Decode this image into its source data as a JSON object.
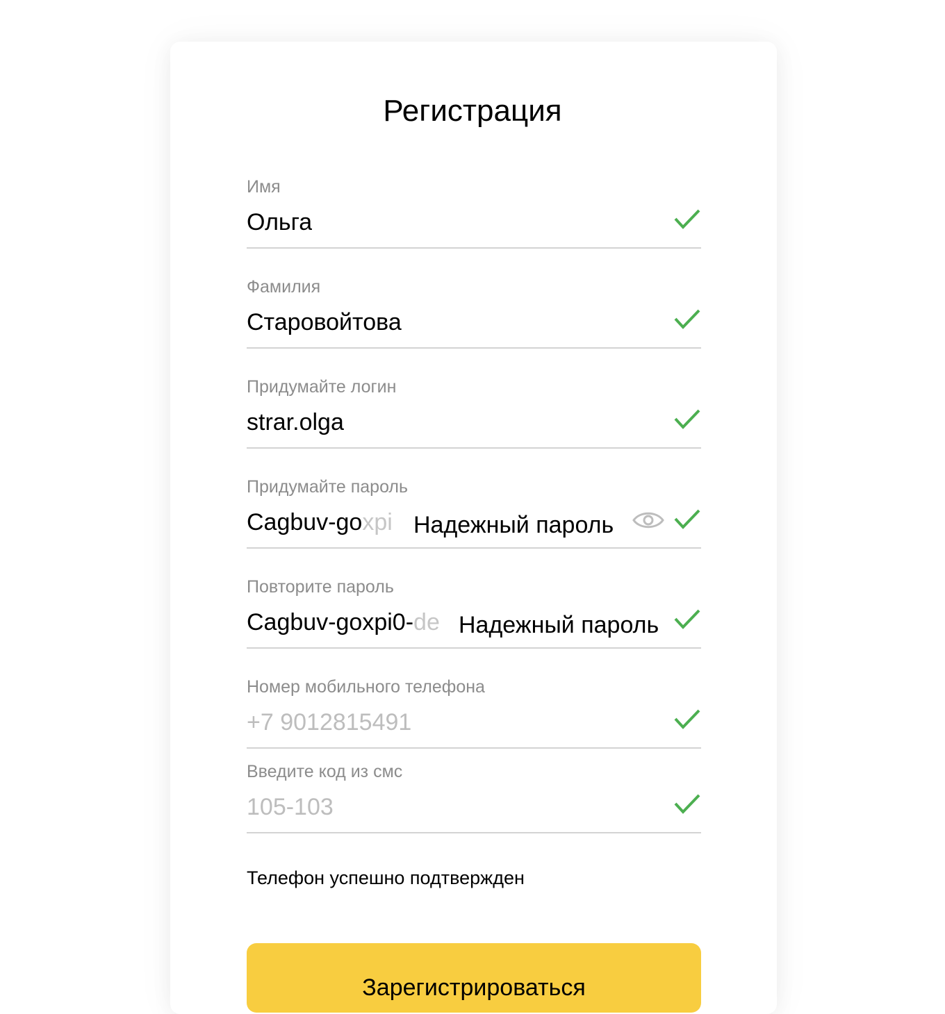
{
  "form": {
    "title": "Регистрация",
    "fields": [
      {
        "label": "Имя",
        "value": "Ольга",
        "valid": true
      },
      {
        "label": "Фамилия",
        "value": "Старовойтова",
        "valid": true
      },
      {
        "label": "Придумайте логин",
        "value": "strar.olga",
        "valid": true
      },
      {
        "label": "Придумайте пароль",
        "value_visible": "Cagbuv-go",
        "value_faded": "xpi",
        "hint": "Надежный пароль",
        "valid": true
      },
      {
        "label": "Повторите пароль",
        "value_visible": "Cagbuv-goxpi0-",
        "value_faded": "de",
        "hint": "Надежный пароль",
        "valid": true
      },
      {
        "label": "Номер мобильного телефона",
        "value": "+7 9012815491",
        "valid": true
      },
      {
        "label": "Введите код из смс",
        "value": "105-103",
        "valid": true
      }
    ],
    "status_text": "Телефон успешно подтвержден",
    "submit_label": "Зарегистрироваться"
  },
  "icons": {
    "check": "check-icon",
    "eye": "eye-icon"
  },
  "colors": {
    "accent": "#f8cd40",
    "check": "#4caf50",
    "label": "#8c8c8c",
    "divider": "#d3d3d3"
  }
}
